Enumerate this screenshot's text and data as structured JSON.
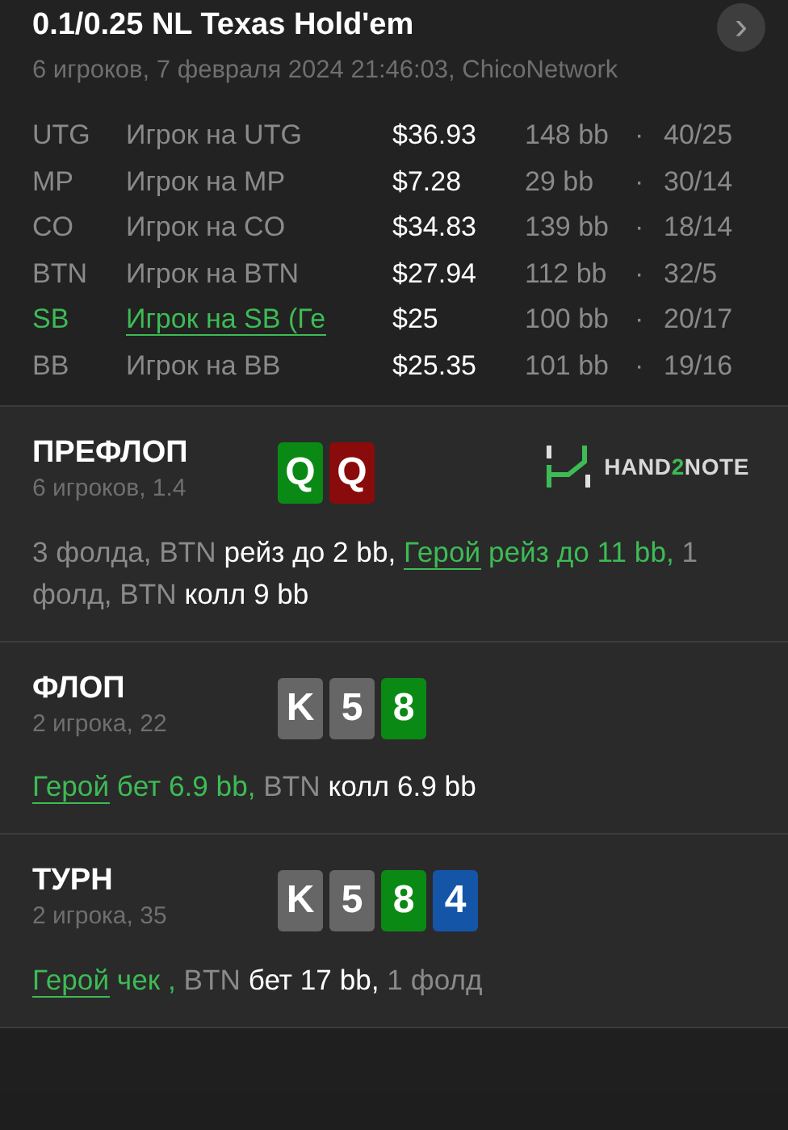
{
  "header": {
    "title": "0.1/0.25 NL Texas Hold'em",
    "subtitle": "6 игроков, 7 февраля 2024 21:46:03, ChicoNetwork",
    "next_button": "›"
  },
  "players": [
    {
      "position": "UTG",
      "name": "Игрок на UTG",
      "stack": "$36.93",
      "bb": "148 bb",
      "separator": "·",
      "stats": "40/25",
      "hero": false
    },
    {
      "position": "MP",
      "name": "Игрок на MP",
      "stack": "$7.28",
      "bb": "29 bb",
      "separator": "·",
      "stats": "30/14",
      "hero": false
    },
    {
      "position": "CO",
      "name": "Игрок на CO",
      "stack": "$34.83",
      "bb": "139 bb",
      "separator": "·",
      "stats": "18/14",
      "hero": false
    },
    {
      "position": "BTN",
      "name": "Игрок на BTN",
      "stack": "$27.94",
      "bb": "112 bb",
      "separator": "·",
      "stats": "32/5",
      "hero": false
    },
    {
      "position": "SB",
      "name": "Игрок на SB (Ге",
      "stack": "$25",
      "bb": "100 bb",
      "separator": "·",
      "stats": "20/17",
      "hero": true
    },
    {
      "position": "BB",
      "name": "Игрок на BB",
      "stack": "$25.35",
      "bb": "101 bb",
      "separator": "·",
      "stats": "19/16",
      "hero": false
    }
  ],
  "streets": [
    {
      "title": "ПРЕФЛОП",
      "info": "6 игроков, 1.4",
      "cards": [
        {
          "rank": "Q",
          "color": "#0a8a14"
        },
        {
          "rank": "Q",
          "color": "#8a0b0b"
        }
      ],
      "logo": [
        {
          "text": "HAND",
          "accent": false
        },
        {
          "text": "2",
          "accent": true
        },
        {
          "text": "NOTE",
          "accent": false
        }
      ],
      "actions": [
        {
          "kind": "other",
          "text": "3 фолда, BTN "
        },
        {
          "kind": "bet",
          "text": "рейз до 2 bb, "
        },
        {
          "kind": "hero-link",
          "text": "Герой"
        },
        {
          "kind": "hero",
          "text": " рейз до 11 bb,"
        },
        {
          "kind": "other",
          "text": " 1 фолд, BTN "
        },
        {
          "kind": "bet",
          "text": "колл 9 bb"
        }
      ]
    },
    {
      "title": "ФЛОП",
      "info": "2 игрока, 22",
      "cards": [
        {
          "rank": "K",
          "color": "#666666"
        },
        {
          "rank": "5",
          "color": "#666666"
        },
        {
          "rank": "8",
          "color": "#0a8a14"
        }
      ],
      "actions": [
        {
          "kind": "hero-link",
          "text": "Герой"
        },
        {
          "kind": "hero",
          "text": " бет 6.9 bb,"
        },
        {
          "kind": "other",
          "text": " BTN "
        },
        {
          "kind": "bet",
          "text": "колл 6.9 bb"
        }
      ]
    },
    {
      "title": "ТУРН",
      "info": "2 игрока, 35",
      "cards": [
        {
          "rank": "K",
          "color": "#666666"
        },
        {
          "rank": "5",
          "color": "#666666"
        },
        {
          "rank": "8",
          "color": "#0a8a14"
        },
        {
          "rank": "4",
          "color": "#1455a8"
        }
      ],
      "actions": [
        {
          "kind": "hero-link",
          "text": "Герой"
        },
        {
          "kind": "hero",
          "text": " чек ,"
        },
        {
          "kind": "other",
          "text": " BTN "
        },
        {
          "kind": "bet",
          "text": "бет 17 bb,"
        },
        {
          "kind": "other",
          "text": " 1 фолд"
        }
      ]
    }
  ]
}
